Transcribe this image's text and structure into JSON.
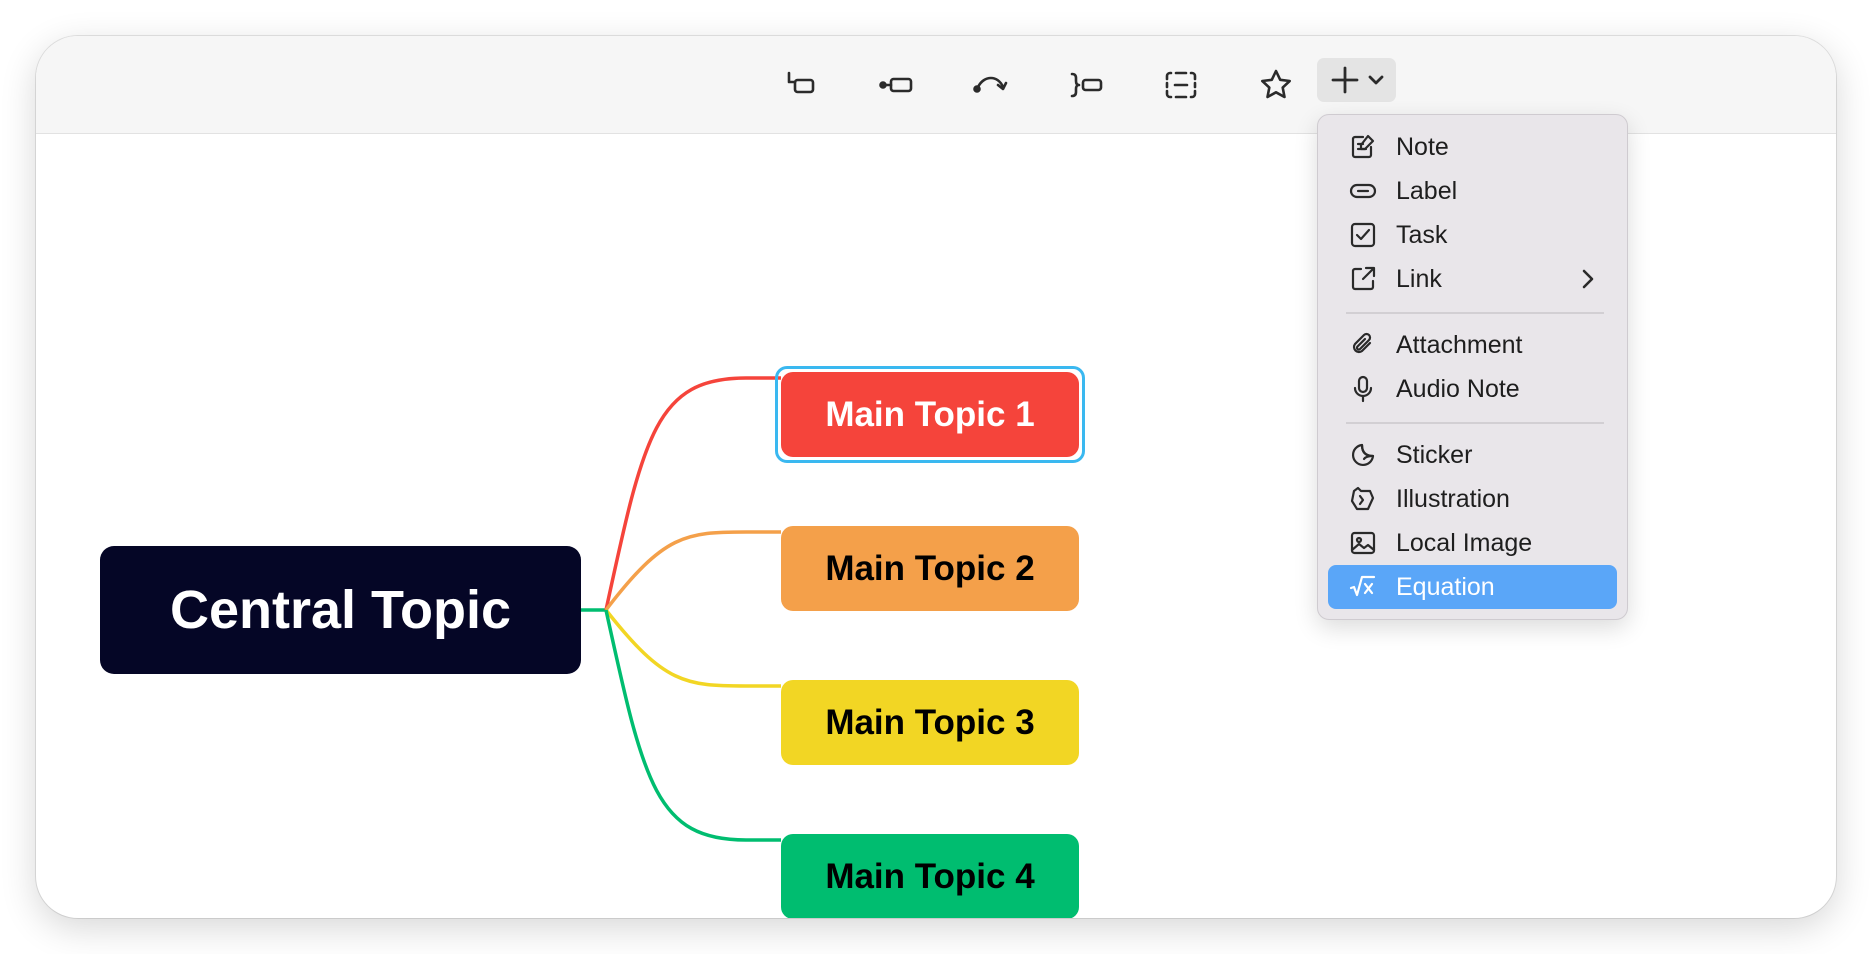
{
  "toolbar": {
    "buttons": [
      {
        "name": "subtopic-icon"
      },
      {
        "name": "topic-icon"
      },
      {
        "name": "relationship-icon"
      },
      {
        "name": "summary-icon"
      },
      {
        "name": "boundary-icon"
      },
      {
        "name": "star-icon"
      }
    ],
    "add_button": {
      "icon": "plus-icon",
      "dropdown_icon": "chevron-down-icon"
    }
  },
  "mindmap": {
    "central": {
      "label": "Central Topic",
      "color": "#050626"
    },
    "topics": [
      {
        "label": "Main Topic 1",
        "color": "#f5443b",
        "text_color": "#ffffff",
        "selected": true
      },
      {
        "label": "Main Topic 2",
        "color": "#f4a04a",
        "text_color": "#000000"
      },
      {
        "label": "Main Topic 3",
        "color": "#f2d624",
        "text_color": "#000000"
      },
      {
        "label": "Main Topic 4",
        "color": "#00bd70",
        "text_color": "#000000"
      }
    ]
  },
  "menu": {
    "items": [
      {
        "label": "Note",
        "icon": "note-icon"
      },
      {
        "label": "Label",
        "icon": "label-icon"
      },
      {
        "label": "Task",
        "icon": "task-icon"
      },
      {
        "label": "Link",
        "icon": "link-icon",
        "has_submenu": true
      },
      {
        "label": "Attachment",
        "icon": "attachment-icon"
      },
      {
        "label": "Audio Note",
        "icon": "microphone-icon"
      },
      {
        "label": "Sticker",
        "icon": "sticker-icon"
      },
      {
        "label": "Illustration",
        "icon": "illustration-icon"
      },
      {
        "label": "Local Image",
        "icon": "image-icon"
      },
      {
        "label": "Equation",
        "icon": "equation-icon",
        "highlighted": true
      }
    ],
    "highlight_color": "#5aa6f8"
  }
}
